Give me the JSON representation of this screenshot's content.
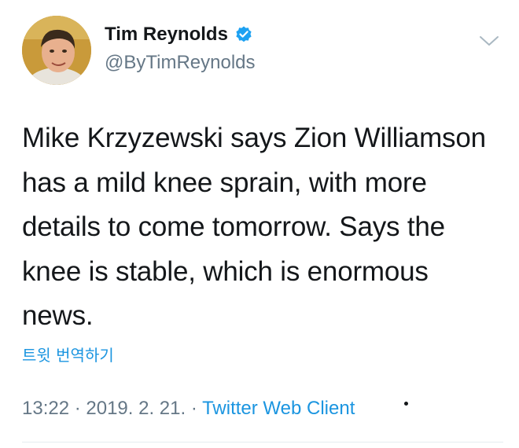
{
  "author": {
    "name": "Tim Reynolds",
    "handle": "@ByTimReynolds",
    "verified": true,
    "avatar": "profile-photo"
  },
  "tweet": {
    "text_lines": [
      "Mike Krzyzewski says Zion Williamson",
      "has a mild knee sprain, with more",
      "details to come tomorrow. Says the",
      "knee is stable, which is enormous",
      "news."
    ],
    "translate_label": "트윗 번역하기"
  },
  "meta": {
    "time": "13:22",
    "separator": " · ",
    "date": "2019. 2. 21.",
    "client": "Twitter Web Client"
  },
  "icons": {
    "verified": "verified-badge-icon",
    "menu": "chevron-down-icon"
  },
  "colors": {
    "text": "#14171a",
    "secondary": "#657786",
    "link": "#1b95e0",
    "verified": "#1da1f2"
  }
}
